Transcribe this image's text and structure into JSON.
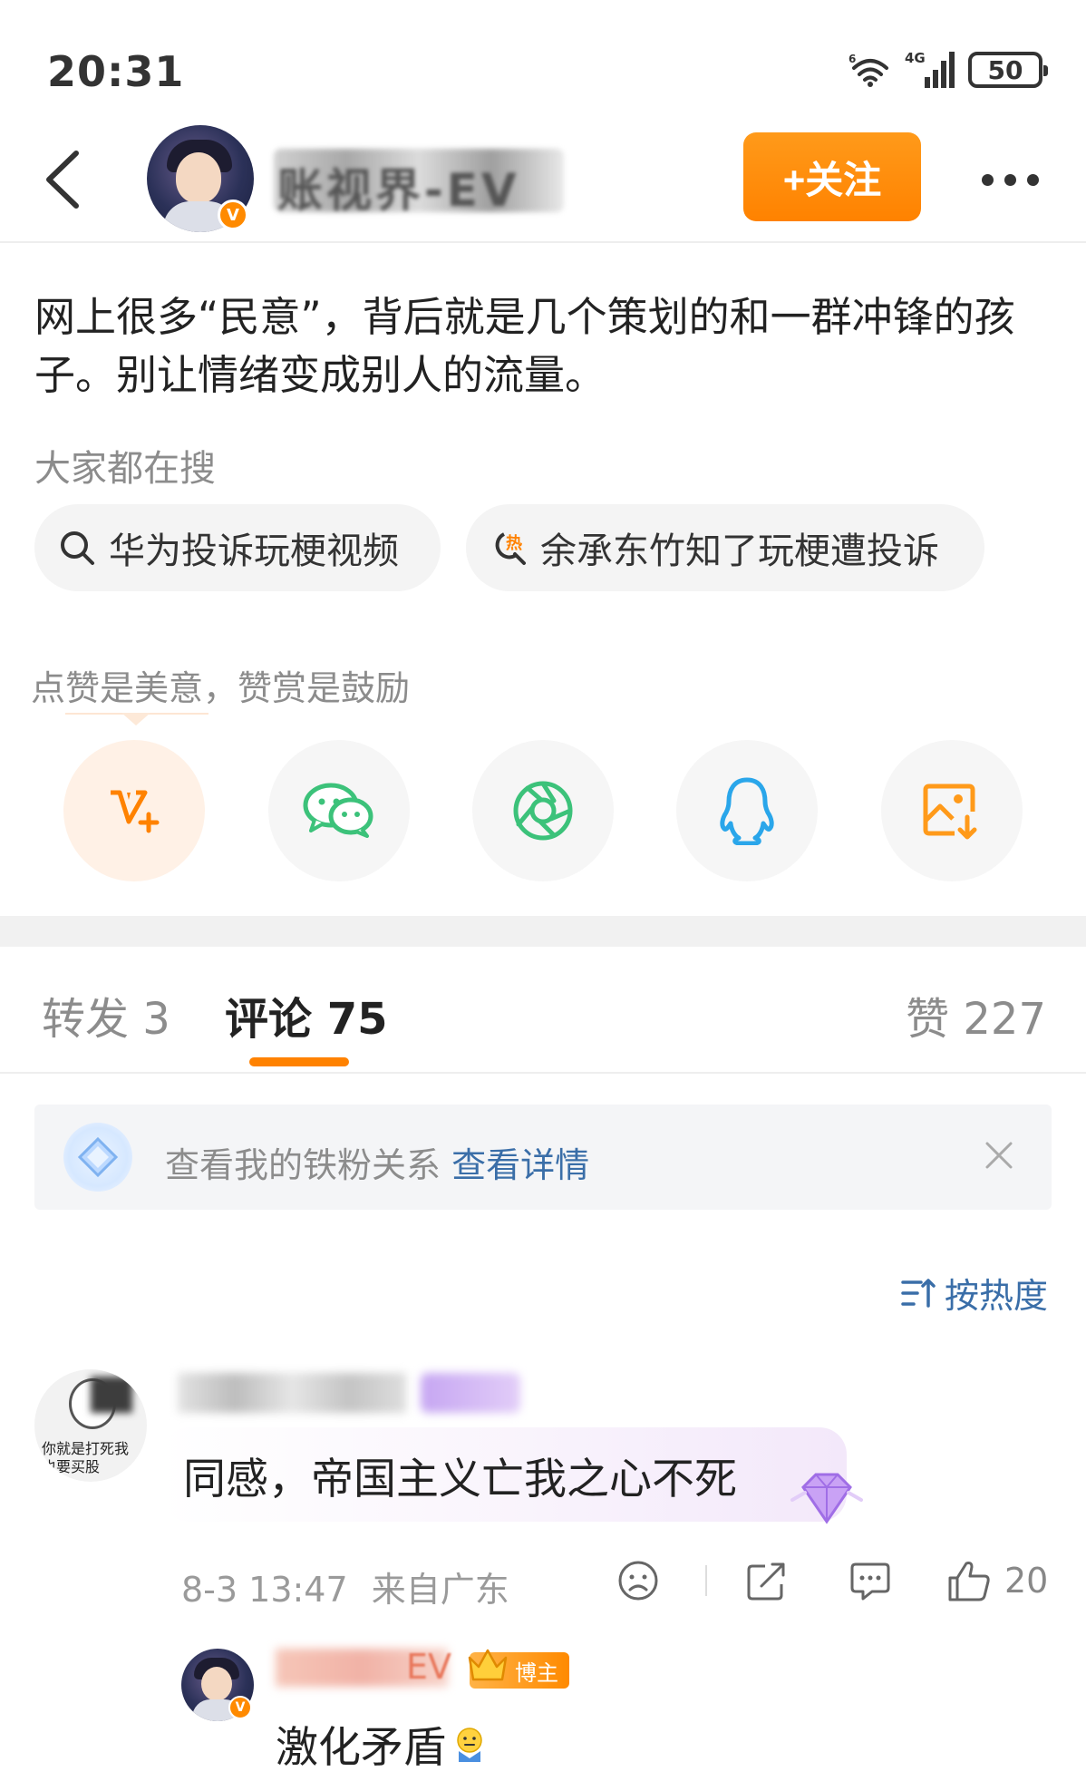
{
  "status_bar": {
    "time": "20:31",
    "network": "4G",
    "wifi_superscript": "6",
    "battery": "50"
  },
  "header": {
    "username_blurred": "账视界-EV",
    "verified_mark": "V",
    "follow_label": "+关注"
  },
  "post": {
    "text": "网上很多“民意”，背后就是几个策划的和一群冲锋的孩子。别让情绪变成别人的流量。"
  },
  "trending": {
    "title": "大家都在搜",
    "chips": [
      {
        "label": "华为投诉玩梗视频",
        "icon": "search-icon"
      },
      {
        "label": "余承东竹知了玩梗遭投诉",
        "icon": "hot-search-icon",
        "icon_text": "热"
      }
    ]
  },
  "reward": {
    "text": "点赞是美意，赞赏是鼓励"
  },
  "share": {
    "buttons": [
      "reward-icon",
      "wechat-icon",
      "moments-icon",
      "qq-icon",
      "save-image-icon"
    ]
  },
  "tabs": {
    "repost": "转发 3",
    "comments": "评论 75",
    "likes": "赞 227"
  },
  "fan_banner": {
    "text": "查看我的铁粉关系 ",
    "link": "查看详情"
  },
  "sort": {
    "label": "按热度"
  },
  "comment": {
    "avatar_caption_1": "你就是打死我",
    "avatar_caption_2": "也要买股",
    "text": "同感，帝国主义亡我之心不死",
    "time": "8-3 13:47",
    "location": "来自广东",
    "likes": "20"
  },
  "reply": {
    "name_tail": "EV",
    "badge": "博主",
    "text": "激化矛盾"
  },
  "colors": {
    "accent": "#ff8200",
    "link": "#3a6ea8",
    "share_green": "#3cc27a",
    "share_qq": "#2aa6ea",
    "share_orange": "#ff9a1a"
  }
}
